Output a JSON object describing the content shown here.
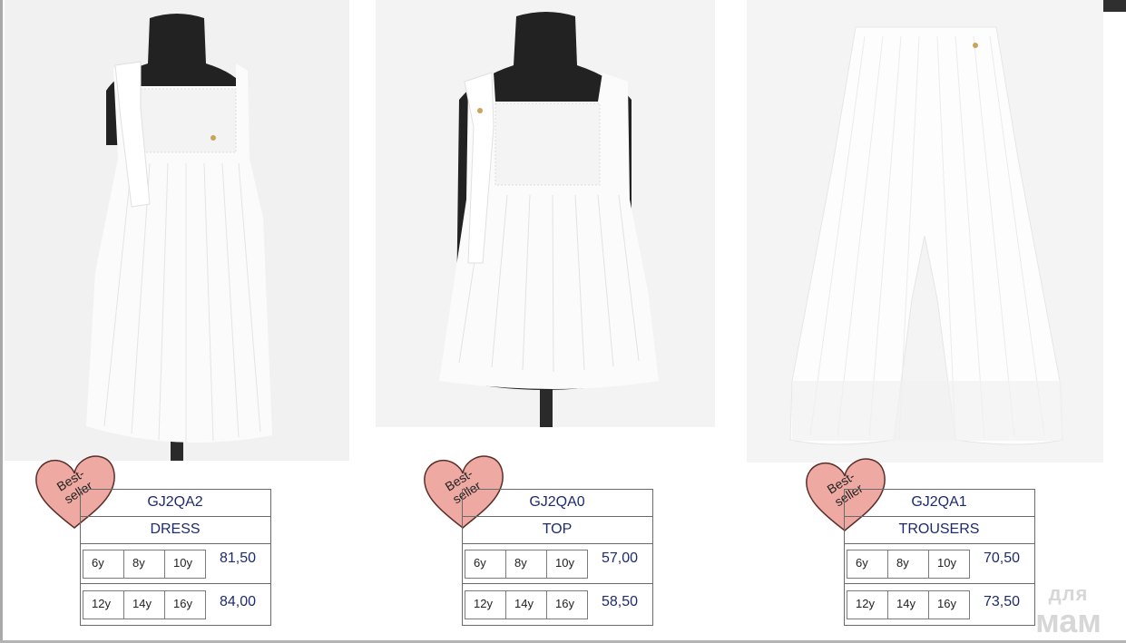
{
  "products": [
    {
      "badge": "Best-\nseller",
      "code": "GJ2QA2",
      "name": "DRESS",
      "rows": [
        {
          "sizes": [
            "6y",
            "8y",
            "10y"
          ],
          "price": "81,50"
        },
        {
          "sizes": [
            "12y",
            "14y",
            "16y"
          ],
          "price": "84,00"
        }
      ]
    },
    {
      "badge": "Best-\nseller",
      "code": "GJ2QA0",
      "name": "TOP",
      "rows": [
        {
          "sizes": [
            "6y",
            "8y",
            "10y"
          ],
          "price": "57,00"
        },
        {
          "sizes": [
            "12y",
            "14y",
            "16y"
          ],
          "price": "58,50"
        }
      ]
    },
    {
      "badge": "Best-\nseller",
      "code": "GJ2QA1",
      "name": "TROUSERS",
      "rows": [
        {
          "sizes": [
            "6y",
            "8y",
            "10y"
          ],
          "price": "70,50"
        },
        {
          "sizes": [
            "12y",
            "14y",
            "16y"
          ],
          "price": "73,50"
        }
      ]
    }
  ],
  "watermark": {
    "line1": "для",
    "line2": "мам"
  },
  "colors": {
    "heart_fill": "#eeaaa2",
    "heart_stroke": "#5a2e2a",
    "table_text": "#1e2a6e",
    "mannequin": "#1f1f1f"
  }
}
